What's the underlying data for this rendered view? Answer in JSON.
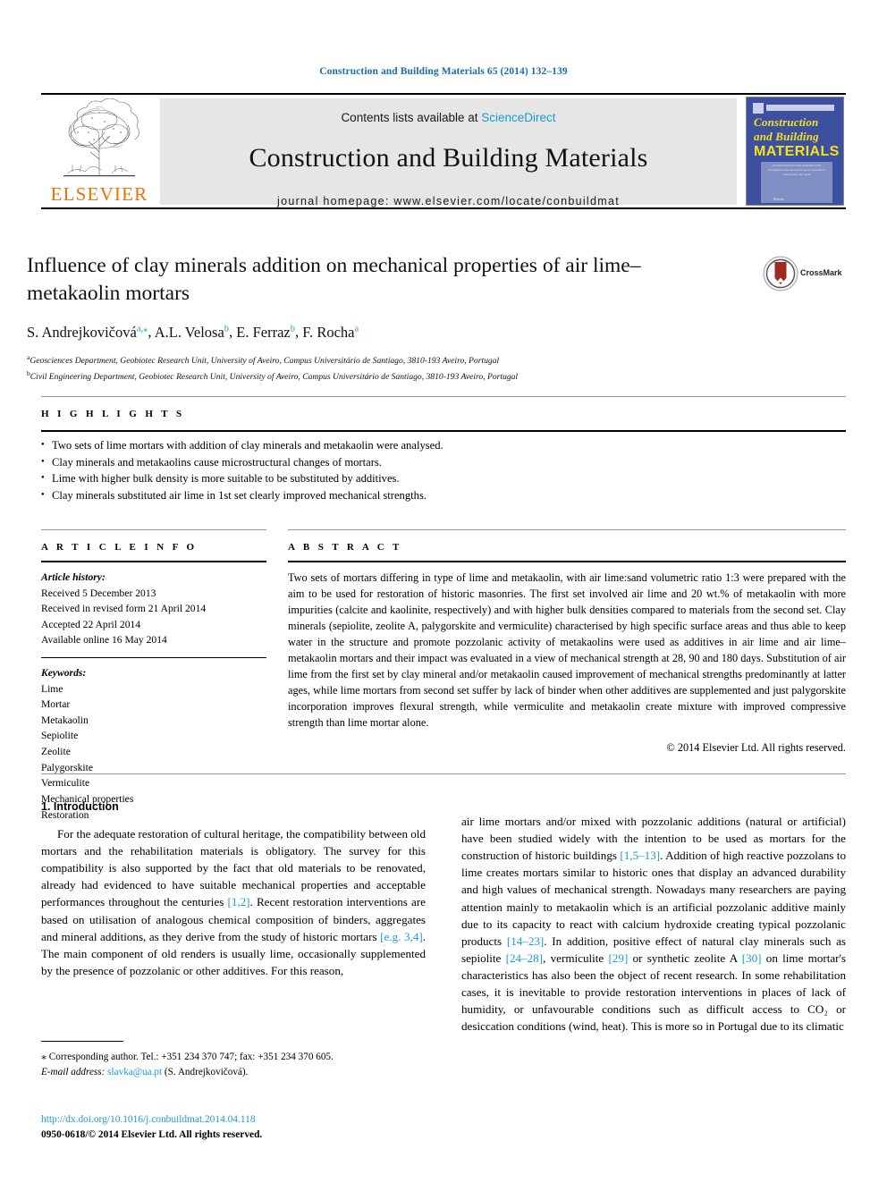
{
  "running_head": "Construction and Building Materials 65 (2014) 132–139",
  "masthead": {
    "contents_prefix": "Contents lists available at ",
    "sciencedirect": "ScienceDirect",
    "journal_title": "Construction and Building Materials",
    "homepage": "journal homepage: www.elsevier.com/locate/conbuildmat",
    "publisher_logo_text": "ELSEVIER",
    "cover": {
      "line1": "Construction",
      "line2": "and Building",
      "line3": "MATERIALS",
      "blurb": "An international journal dedicated to the investigation and innovative use of materials in construction and repair",
      "foot": "Elsevier"
    }
  },
  "crossmark": {
    "label": "CrossMark"
  },
  "title": "Influence of clay minerals addition on mechanical properties of air lime–metakaolin mortars",
  "authors": [
    {
      "name": "S. Andrejkovičová",
      "sup": "a,⁎"
    },
    {
      "name": "A.L. Velosa",
      "sup": "b"
    },
    {
      "name": "E. Ferraz",
      "sup": "b"
    },
    {
      "name": "F. Rocha",
      "sup": "a"
    }
  ],
  "affiliations": [
    {
      "marker": "a",
      "text": "Geosciences Department, Geobiotec Research Unit, University of Aveiro, Campus Universitário de Santiago, 3810-193 Aveiro, Portugal"
    },
    {
      "marker": "b",
      "text": "Civil Engineering Department, Geobiotec Research Unit, University of Aveiro, Campus Universitário de Santiago, 3810-193 Aveiro, Portugal"
    }
  ],
  "highlights": {
    "label": "H I G H L I G H T S",
    "items": [
      "Two sets of lime mortars with addition of clay minerals and metakaolin were analysed.",
      "Clay minerals and metakaolins cause microstructural changes of mortars.",
      "Lime with higher bulk density is more suitable to be substituted by additives.",
      "Clay minerals substituted air lime in 1st set clearly improved mechanical strengths."
    ]
  },
  "article_info": {
    "label": "A R T I C L E   I N F O",
    "history_label": "Article history:",
    "history": [
      "Received 5 December 2013",
      "Received in revised form 21 April 2014",
      "Accepted 22 April 2014",
      "Available online 16 May 2014"
    ],
    "keywords_label": "Keywords:",
    "keywords": [
      "Lime",
      "Mortar",
      "Metakaolin",
      "Sepiolite",
      "Zeolite",
      "Palygorskite",
      "Vermiculite",
      "Mechanical properties",
      "Restoration"
    ]
  },
  "abstract": {
    "label": "A B S T R A C T",
    "text": "Two sets of mortars differing in type of lime and metakaolin, with air lime:sand volumetric ratio 1:3 were prepared with the aim to be used for restoration of historic masonries. The first set involved air lime and 20 wt.% of metakaolin with more impurities (calcite and kaolinite, respectively) and with higher bulk densities compared to materials from the second set. Clay minerals (sepiolite, zeolite A, palygorskite and vermiculite) characterised by high specific surface areas and thus able to keep water in the structure and promote pozzolanic activity of metakaolins were used as additives in air lime and air lime–metakaolin mortars and their impact was evaluated in a view of mechanical strength at 28, 90 and 180 days. Substitution of air lime from the first set by clay mineral and/or metakaolin caused improvement of mechanical strengths predominantly at latter ages, while lime mortars from second set suffer by lack of binder when other additives are supplemented and just palygorskite incorporation improves flexural strength, while vermiculite and metakaolin create mixture with improved compressive strength than lime mortar alone.",
    "copyright": "© 2014 Elsevier Ltd. All rights reserved."
  },
  "body": {
    "section_heading": "1. Introduction",
    "left_paragraph_parts": [
      {
        "t": "For the adequate restoration of cultural heritage, the compatibility between old mortars and the rehabilitation materials is obligatory. The survey for this compatibility is also supported by the fact that old materials to be renovated, already had evidenced to have suitable mechanical properties and acceptable performances throughout the centuries ",
        "ref": false
      },
      {
        "t": "[1,2]",
        "ref": true
      },
      {
        "t": ". Recent restoration interventions are based on utilisation of analogous chemical composition of binders, aggregates and mineral additions, as they derive from the study of historic mortars ",
        "ref": false
      },
      {
        "t": "[e.g. 3,4]",
        "ref": true
      },
      {
        "t": ". The main component of old renders is usually lime, occasionally supplemented by the presence of pozzolanic or other additives. For this reason,",
        "ref": false
      }
    ],
    "right_paragraph_parts": [
      {
        "t": "air lime mortars and/or mixed with pozzolanic additions (natural or artificial) have been studied widely with the intention to be used as mortars for the construction of historic buildings ",
        "ref": false
      },
      {
        "t": "[1,5–13]",
        "ref": true
      },
      {
        "t": ". Addition of high reactive pozzolans to lime creates mortars similar to historic ones that display an advanced durability and high values of mechanical strength. Nowadays many researchers are paying attention mainly to metakaolin which is an artificial pozzolanic additive mainly due to its capacity to react with calcium hydroxide creating typical pozzolanic products ",
        "ref": false
      },
      {
        "t": "[14–23]",
        "ref": true
      },
      {
        "t": ". In addition, positive effect of natural clay minerals such as sepiolite ",
        "ref": false
      },
      {
        "t": "[24–28]",
        "ref": true
      },
      {
        "t": ", vermiculite ",
        "ref": false
      },
      {
        "t": "[29]",
        "ref": true
      },
      {
        "t": " or synthetic zeolite A ",
        "ref": false
      },
      {
        "t": "[30]",
        "ref": true
      },
      {
        "t": " on lime mortar's characteristics has also been the object of recent research. In some rehabilitation cases, it is inevitable to provide restoration interventions in places of lack of humidity, or unfavourable conditions such as difficult access to CO₂ or desiccation conditions (wind, heat). This is more so in Portugal due to its climatic",
        "ref": false
      }
    ]
  },
  "footnote": {
    "star": "⁎",
    "corresponding": "Corresponding author. Tel.: +351 234 370 747; fax: +351 234 370 605.",
    "email_label": "E-mail address:",
    "email": "slavka@ua.pt",
    "email_owner": "(S. Andrejkovičová)."
  },
  "footer": {
    "doi": "http://dx.doi.org/10.1016/j.conbuildmat.2014.04.118",
    "issn": "0950-0618/© 2014 Elsevier Ltd. All rights reserved."
  },
  "colors": {
    "link": "#1b9ad6",
    "runhead": "#1b6ca8",
    "elsevier_orange": "#e8730a",
    "cover_blue": "#3d4fa1",
    "cover_yellow": "#f4e21a",
    "band_grey": "#e6e6e6"
  }
}
